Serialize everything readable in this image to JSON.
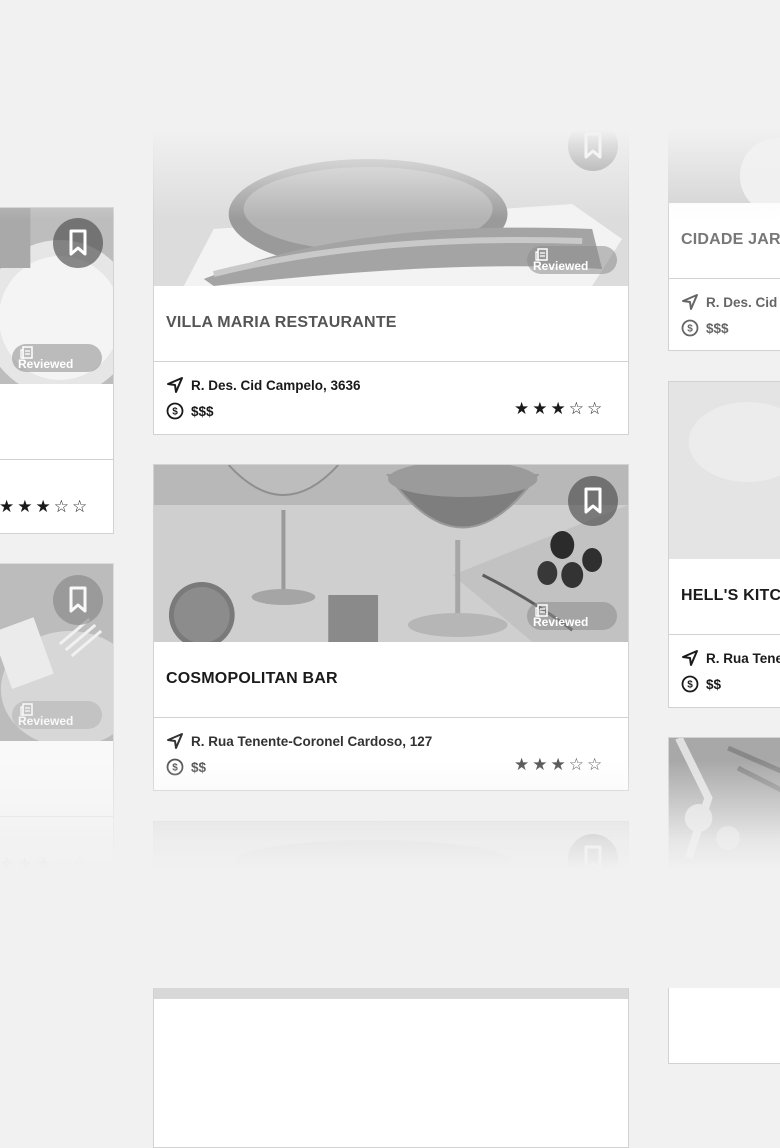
{
  "colors": {
    "background": "#f1f1f1",
    "card": "#ffffff",
    "border": "#d2d2d2",
    "text": "#1a1a1a"
  },
  "cards": {
    "left1": {
      "rating_stars": "★★★☆☆",
      "rating": 3,
      "badge": "Reviewed"
    },
    "left2": {
      "rating_stars": "★★★☆☆",
      "rating": 3,
      "badge": "Reviewed"
    },
    "villa": {
      "name": "VILLA MARIA RESTAURANTE",
      "address": "R. Des. Cid Campelo, 3636",
      "price": "$$$",
      "rating_stars": "★★★☆☆",
      "rating": 3,
      "badge": "Reviewed"
    },
    "cosmo": {
      "name": "COSMOPOLITAN BAR",
      "address": "R. Rua Tenente-Coronel Cardoso, 127",
      "price": "$$",
      "rating_stars": "★★★☆☆",
      "rating": 3,
      "badge": "Reviewed"
    },
    "cidade": {
      "name": "CIDADE JAR",
      "address": "R. Des. Cid",
      "price": "$$$"
    },
    "hells": {
      "name": "HELL'S KITC",
      "address": "R. Rua Tene",
      "price": "$$"
    }
  },
  "icons": {
    "bookmark": "bookmark-icon",
    "location": "navigation-arrow-icon",
    "price": "dollar-coin-icon",
    "reviewed": "document-icon"
  }
}
